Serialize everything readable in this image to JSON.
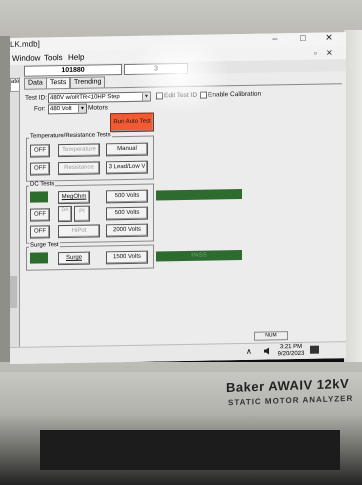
{
  "window": {
    "title": "LK.mdb]",
    "minimize_label": "–",
    "maximize_label": "□",
    "close_label": "✕"
  },
  "menu": {
    "items": [
      "Window",
      "Tools",
      "Help"
    ],
    "restore_label": "▫",
    "mdi_close_label": "✕"
  },
  "id_row": {
    "id_value": "101880",
    "count_value": "3"
  },
  "left_panel": {
    "tab_label": "ate"
  },
  "tabs": [
    {
      "label": "Data",
      "active": false
    },
    {
      "label": "Tests",
      "active": true
    },
    {
      "label": "Trending",
      "active": false
    }
  ],
  "test_setup": {
    "test_id_label": "Test ID:",
    "test_id_value": "480V w/oRTR<10HP Step",
    "edit_test_id_label": "Edit Test ID",
    "enable_calibration_label": "Enable Calibration",
    "for_label": "For:",
    "voltage_value": "480 Volt",
    "motors_label": "Motors",
    "run_auto_test_label": "Run Auto Test"
  },
  "temp_resistance": {
    "title": "Temperature/Resistance Tests",
    "rows": [
      {
        "toggle": "OFF",
        "action": "Temperature",
        "option": "Manual"
      },
      {
        "toggle": "OFF",
        "action": "Resistance",
        "option": "3 Lead/Low V"
      }
    ]
  },
  "dc_tests": {
    "title": "DC Tests",
    "megohm_label": "MegOhm",
    "megohm_volts": "500 Volts",
    "off_label_1": "OFF",
    "da_label": "DA",
    "pi_label": "PI",
    "pi_volts": "500 Volts",
    "off_label_2": "OFF",
    "hipot_label": "HiPot",
    "hipot_volts": "2000 Volts"
  },
  "surge_test": {
    "title": "Surge Test",
    "surge_label": "Surge",
    "surge_volts": "1500 Volts",
    "result": "PASS"
  },
  "statusbar": {
    "text": "NUM"
  },
  "taskbar": {
    "tray_up": "∧",
    "time": "3:21 PM",
    "date": "9/20/2023"
  },
  "case_branding": {
    "brand": "Baker AWAIV 12kV",
    "subtitle": "STATIC MOTOR ANALYZER"
  },
  "colors": {
    "result_green": "#2e6b2f",
    "run_auto_test": "#f25a33"
  }
}
